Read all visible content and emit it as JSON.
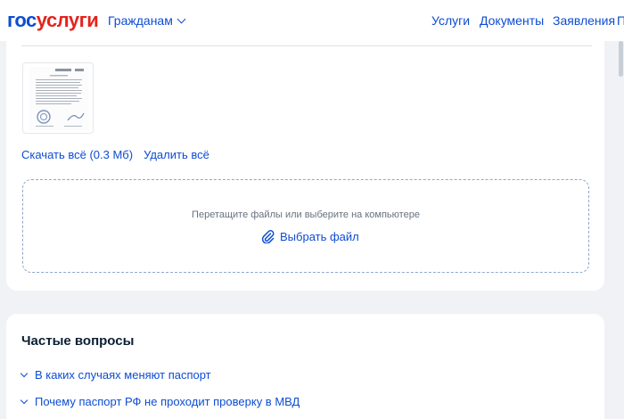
{
  "header": {
    "logo_part1": "гос",
    "logo_part2": "услуги",
    "audience": "Гражданам",
    "nav": [
      "Услуги",
      "Документы",
      "Заявления",
      "П"
    ]
  },
  "upload": {
    "download_all": "Скачать всё (0.3 Мб)",
    "delete_all": "Удалить всё",
    "drop_hint": "Перетащите файлы или выберите на компьютере",
    "choose_file": "Выбрать файл",
    "icons": {
      "choose": "paperclip-icon"
    }
  },
  "faq": {
    "title": "Частые вопросы",
    "items": [
      "В каких случаях меняют паспорт",
      "Почему паспорт РФ не проходит проверку в МВД"
    ]
  },
  "colors": {
    "link": "#0d4cd3",
    "logo_red": "#e3241d",
    "text": "#0b1f33",
    "muted": "#66727f"
  }
}
